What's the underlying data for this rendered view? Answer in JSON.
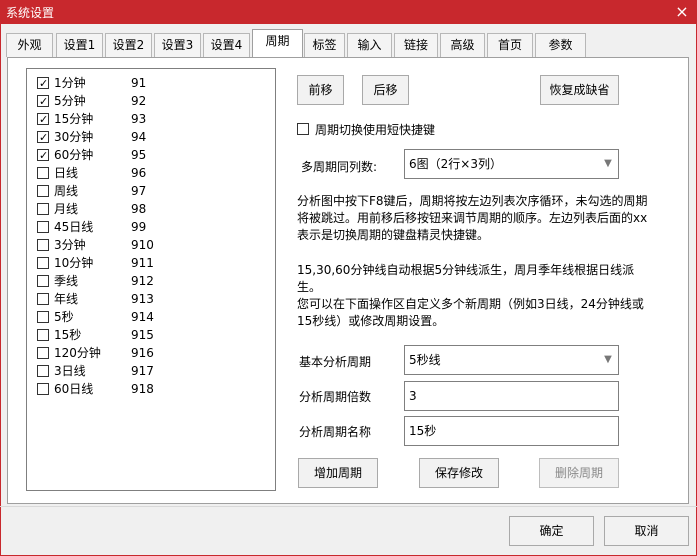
{
  "window": {
    "title": "系统设置",
    "close_icon": "close-icon"
  },
  "tabs": [
    {
      "label": "外观"
    },
    {
      "label": "设置1"
    },
    {
      "label": "设置2"
    },
    {
      "label": "设置3"
    },
    {
      "label": "设置4"
    },
    {
      "label": "周期",
      "active": true
    },
    {
      "label": "标签"
    },
    {
      "label": "输入"
    },
    {
      "label": "链接"
    },
    {
      "label": "高级"
    },
    {
      "label": "首页"
    },
    {
      "label": "参数"
    }
  ],
  "period_list": [
    {
      "label": "1分钟",
      "key": "91",
      "checked": true
    },
    {
      "label": "5分钟",
      "key": "92",
      "checked": true
    },
    {
      "label": "15分钟",
      "key": "93",
      "checked": true
    },
    {
      "label": "30分钟",
      "key": "94",
      "checked": true
    },
    {
      "label": "60分钟",
      "key": "95",
      "checked": true
    },
    {
      "label": "日线",
      "key": "96",
      "checked": false
    },
    {
      "label": "周线",
      "key": "97",
      "checked": false
    },
    {
      "label": "月线",
      "key": "98",
      "checked": false
    },
    {
      "label": "45日线",
      "key": "99",
      "checked": false
    },
    {
      "label": "3分钟",
      "key": "910",
      "checked": false
    },
    {
      "label": "10分钟",
      "key": "911",
      "checked": false
    },
    {
      "label": "季线",
      "key": "912",
      "checked": false
    },
    {
      "label": "年线",
      "key": "913",
      "checked": false
    },
    {
      "label": "5秒",
      "key": "914",
      "checked": false
    },
    {
      "label": "15秒",
      "key": "915",
      "checked": false
    },
    {
      "label": "120分钟",
      "key": "916",
      "checked": false
    },
    {
      "label": "3日线",
      "key": "917",
      "checked": false
    },
    {
      "label": "60日线",
      "key": "918",
      "checked": false
    }
  ],
  "buttons": {
    "move_up": "前移",
    "move_down": "后移",
    "restore_default": "恢复成缺省",
    "add_period": "增加周期",
    "save_changes": "保存修改",
    "delete_period": "删除周期",
    "ok": "确定",
    "cancel": "取消"
  },
  "options": {
    "shortcut_label": "周期切换使用短快捷键",
    "shortcut_checked": false,
    "multi_period_label": "多周期同列数:",
    "multi_period_value": "6图（2行×3列）"
  },
  "descriptions": {
    "line1": "分析图中按下F8键后，周期将按左边列表次序循环，未勾选的周期",
    "line2": "将被跳过。用前移后移按钮来调节周期的顺序。左边列表后面的xx",
    "line3": "表示是切换周期的键盘精灵快捷键。",
    "line4": "15,30,60分钟线自动根据5分钟线派生，周月季年线根据日线派生。",
    "line5": "您可以在下面操作区自定义多个新周期（例如3日线，24分钟线或",
    "line6": "15秒线）或修改周期设置。"
  },
  "period_form": {
    "base_label": "基本分析周期",
    "base_value": "5秒线",
    "multiple_label": "分析周期倍数",
    "multiple_value": "3",
    "name_label": "分析周期名称",
    "name_value": "15秒"
  },
  "icons": {
    "select_arrow": "chevron-down-icon"
  }
}
